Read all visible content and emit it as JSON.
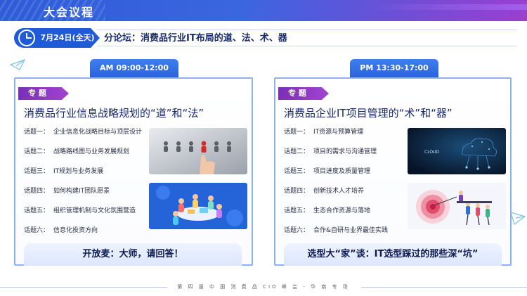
{
  "header": {
    "title": "大会议程"
  },
  "schedule": {
    "date": "7月24日(全天)",
    "forum_title": "分论坛：消费品行业IT布局的道、法、术、器"
  },
  "sessions": [
    {
      "time": "AM 09:00-12:00",
      "tag": "专 题",
      "title": "消费品行业信息战略规划的“道”和“法”",
      "topics": [
        {
          "num": "话题一：",
          "text": "企业信息化战略目标与顶层设计"
        },
        {
          "num": "话题二：",
          "text": "战略路线图与业务发展规划"
        },
        {
          "num": "话题三：",
          "text": "IT规划与业务发展"
        },
        {
          "num": "话题四：",
          "text": "如何构建IT团队愿景"
        },
        {
          "num": "话题五：",
          "text": "组织管理机制与文化氛围营造"
        },
        {
          "num": "话题六：",
          "text": "信息化投资方向"
        }
      ],
      "callout": "开放麦：大师，请回答！"
    },
    {
      "time": "PM 13:30-17:00",
      "tag": "专 题",
      "title": "消费品企业IT项目管理的“术”和“器”",
      "topics": [
        {
          "num": "话题一：",
          "text": "IT资源与预算管理"
        },
        {
          "num": "话题二：",
          "text": "项目的需求与沟通管理"
        },
        {
          "num": "话题三：",
          "text": "项目进度及质量管理"
        },
        {
          "num": "话题四：",
          "text": "创新技术人才培养"
        },
        {
          "num": "话题五：",
          "text": "生态合作资源与落地"
        },
        {
          "num": "话题六：",
          "text": "合作&自研与业界最佳实践"
        }
      ],
      "callout": "选型大“家”谈：IT选型踩过的那些深“坑”",
      "cloud_label": "CLOUD"
    }
  ],
  "footer": {
    "text": "第 四 届 中 国 消 费 品 CIO 峰 会 - 华 南 专 场"
  },
  "colors": {
    "primary_blue": "#1f5ad8",
    "accent_purple": "#9a3fd0",
    "tag_purple": "#7a2fb8",
    "title_navy": "#1a2a6c"
  }
}
